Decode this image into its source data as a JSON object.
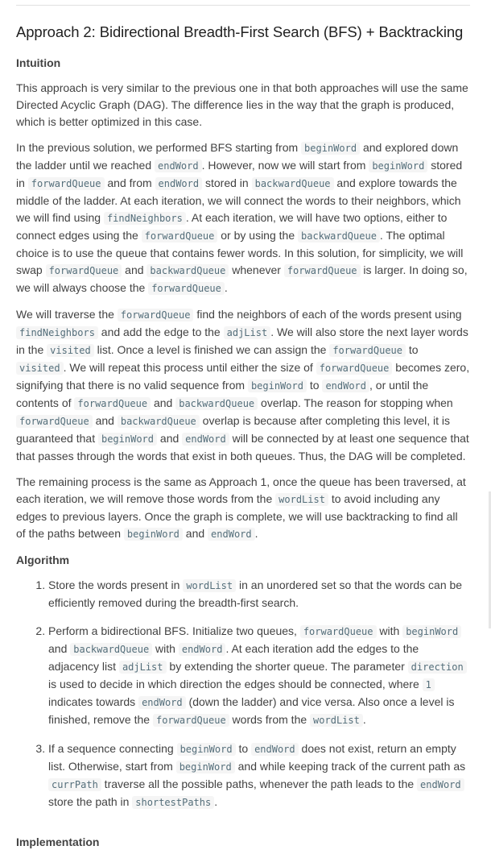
{
  "title": "Approach 2: Bidirectional Breadth-First Search (BFS) + Backtracking",
  "intuition_heading": "Intuition",
  "intuition_p1": "This approach is very similar to the previous one in that both approaches will use the same Directed Acyclic Graph (DAG). The difference lies in the way that the graph is produced, which is better optimized in this case.",
  "p2": [
    {
      "t": "In the previous solution, we performed BFS starting from "
    },
    {
      "c": "beginWord"
    },
    {
      "t": " and explored down the ladder until we reached "
    },
    {
      "c": "endWord"
    },
    {
      "t": ". However, now we will start from "
    },
    {
      "c": "beginWord"
    },
    {
      "t": " stored in "
    },
    {
      "c": "forwardQueue"
    },
    {
      "t": " and from "
    },
    {
      "c": "endWord"
    },
    {
      "t": " stored in "
    },
    {
      "c": "backwardQueue"
    },
    {
      "t": " and explore towards the middle of the ladder. At each iteration, we will connect the words to their neighbors, which we will find using "
    },
    {
      "c": "findNeighbors"
    },
    {
      "t": ". At each iteration, we will have two options, either to connect edges using the "
    },
    {
      "c": "forwardQueue"
    },
    {
      "t": " or by using the "
    },
    {
      "c": "backwardQueue"
    },
    {
      "t": ". The optimal choice is to use the queue that contains fewer words. In this solution, for simplicity, we will swap "
    },
    {
      "c": "forwardQueue"
    },
    {
      "t": " and "
    },
    {
      "c": "backwardQueue"
    },
    {
      "t": " whenever "
    },
    {
      "c": "forwardQueue"
    },
    {
      "t": " is larger. In doing so, we will always choose the "
    },
    {
      "c": "forwardQueue"
    },
    {
      "t": "."
    }
  ],
  "p3": [
    {
      "t": "We will traverse the "
    },
    {
      "c": "forwardQueue"
    },
    {
      "t": " find the neighbors of each of the words present using "
    },
    {
      "c": "findNeighbors"
    },
    {
      "t": " and add the edge to the "
    },
    {
      "c": "adjList"
    },
    {
      "t": ". We will also store the next layer words in the "
    },
    {
      "c": "visited"
    },
    {
      "t": " list. Once a level is finished we can assign the "
    },
    {
      "c": "forwardQueue"
    },
    {
      "t": " to "
    },
    {
      "c": "visited"
    },
    {
      "t": ". We will repeat this process until either the size of "
    },
    {
      "c": "forwardQueue"
    },
    {
      "t": " becomes zero, signifying that there is no valid sequence from "
    },
    {
      "c": "beginWord"
    },
    {
      "t": " to "
    },
    {
      "c": "endWord"
    },
    {
      "t": ", or until the contents of "
    },
    {
      "c": "forwardQueue"
    },
    {
      "t": " and "
    },
    {
      "c": "backwardQueue"
    },
    {
      "t": " overlap. The reason for stopping when "
    },
    {
      "c": "forwardQueue"
    },
    {
      "t": " and "
    },
    {
      "c": "backwardQueue"
    },
    {
      "t": " overlap is because after completing this level, it is guaranteed that "
    },
    {
      "c": "beginWord"
    },
    {
      "t": " and "
    },
    {
      "c": "endWord"
    },
    {
      "t": " will be connected by at least one sequence that that passes through the words that exist in both queues. Thus, the DAG will be completed."
    }
  ],
  "p4": [
    {
      "t": "The remaining process is the same as Approach 1, once the queue has been traversed, at each iteration, we will remove those words from the "
    },
    {
      "c": "wordList"
    },
    {
      "t": " to avoid including any edges to previous layers. Once the graph is complete, we will use backtracking to find all of the paths between "
    },
    {
      "c": "beginWord"
    },
    {
      "t": " and "
    },
    {
      "c": "endWord"
    },
    {
      "t": "."
    }
  ],
  "algorithm_heading": "Algorithm",
  "steps": [
    [
      {
        "t": "Store the words present in "
      },
      {
        "c": "wordList"
      },
      {
        "t": " in an unordered set so that the words can be efficiently removed during the breadth-first search."
      }
    ],
    [
      {
        "t": "Perform a bidirectional BFS. Initialize two queues, "
      },
      {
        "c": "forwardQueue"
      },
      {
        "t": " with "
      },
      {
        "c": "beginWord"
      },
      {
        "t": " and "
      },
      {
        "c": "backwardQueue"
      },
      {
        "t": " with "
      },
      {
        "c": "endWord"
      },
      {
        "t": ". At each iteration add the edges to the adjacency list "
      },
      {
        "c": "adjList"
      },
      {
        "t": " by extending the shorter queue. The parameter "
      },
      {
        "c": "direction"
      },
      {
        "t": " is used to decide in which direction the edges should be connected, where "
      },
      {
        "c": "1"
      },
      {
        "t": " indicates towards "
      },
      {
        "c": "endWord"
      },
      {
        "t": " (down the ladder) and vice versa. Also once a level is finished, remove the "
      },
      {
        "c": "forwardQueue"
      },
      {
        "t": " words from the "
      },
      {
        "c": "wordList"
      },
      {
        "t": "."
      }
    ],
    [
      {
        "t": "If a sequence connecting "
      },
      {
        "c": "beginWord"
      },
      {
        "t": " to "
      },
      {
        "c": "endWord"
      },
      {
        "t": " does not exist, return an empty list. Otherwise, start from "
      },
      {
        "c": "beginWord"
      },
      {
        "t": " and while keeping track of the current path as "
      },
      {
        "c": "currPath"
      },
      {
        "t": " traverse all the possible paths, whenever the path leads to the "
      },
      {
        "c": "endWord"
      },
      {
        "t": " store the path in "
      },
      {
        "c": "shortestPaths"
      },
      {
        "t": "."
      }
    ]
  ],
  "implementation_heading": "Implementation"
}
